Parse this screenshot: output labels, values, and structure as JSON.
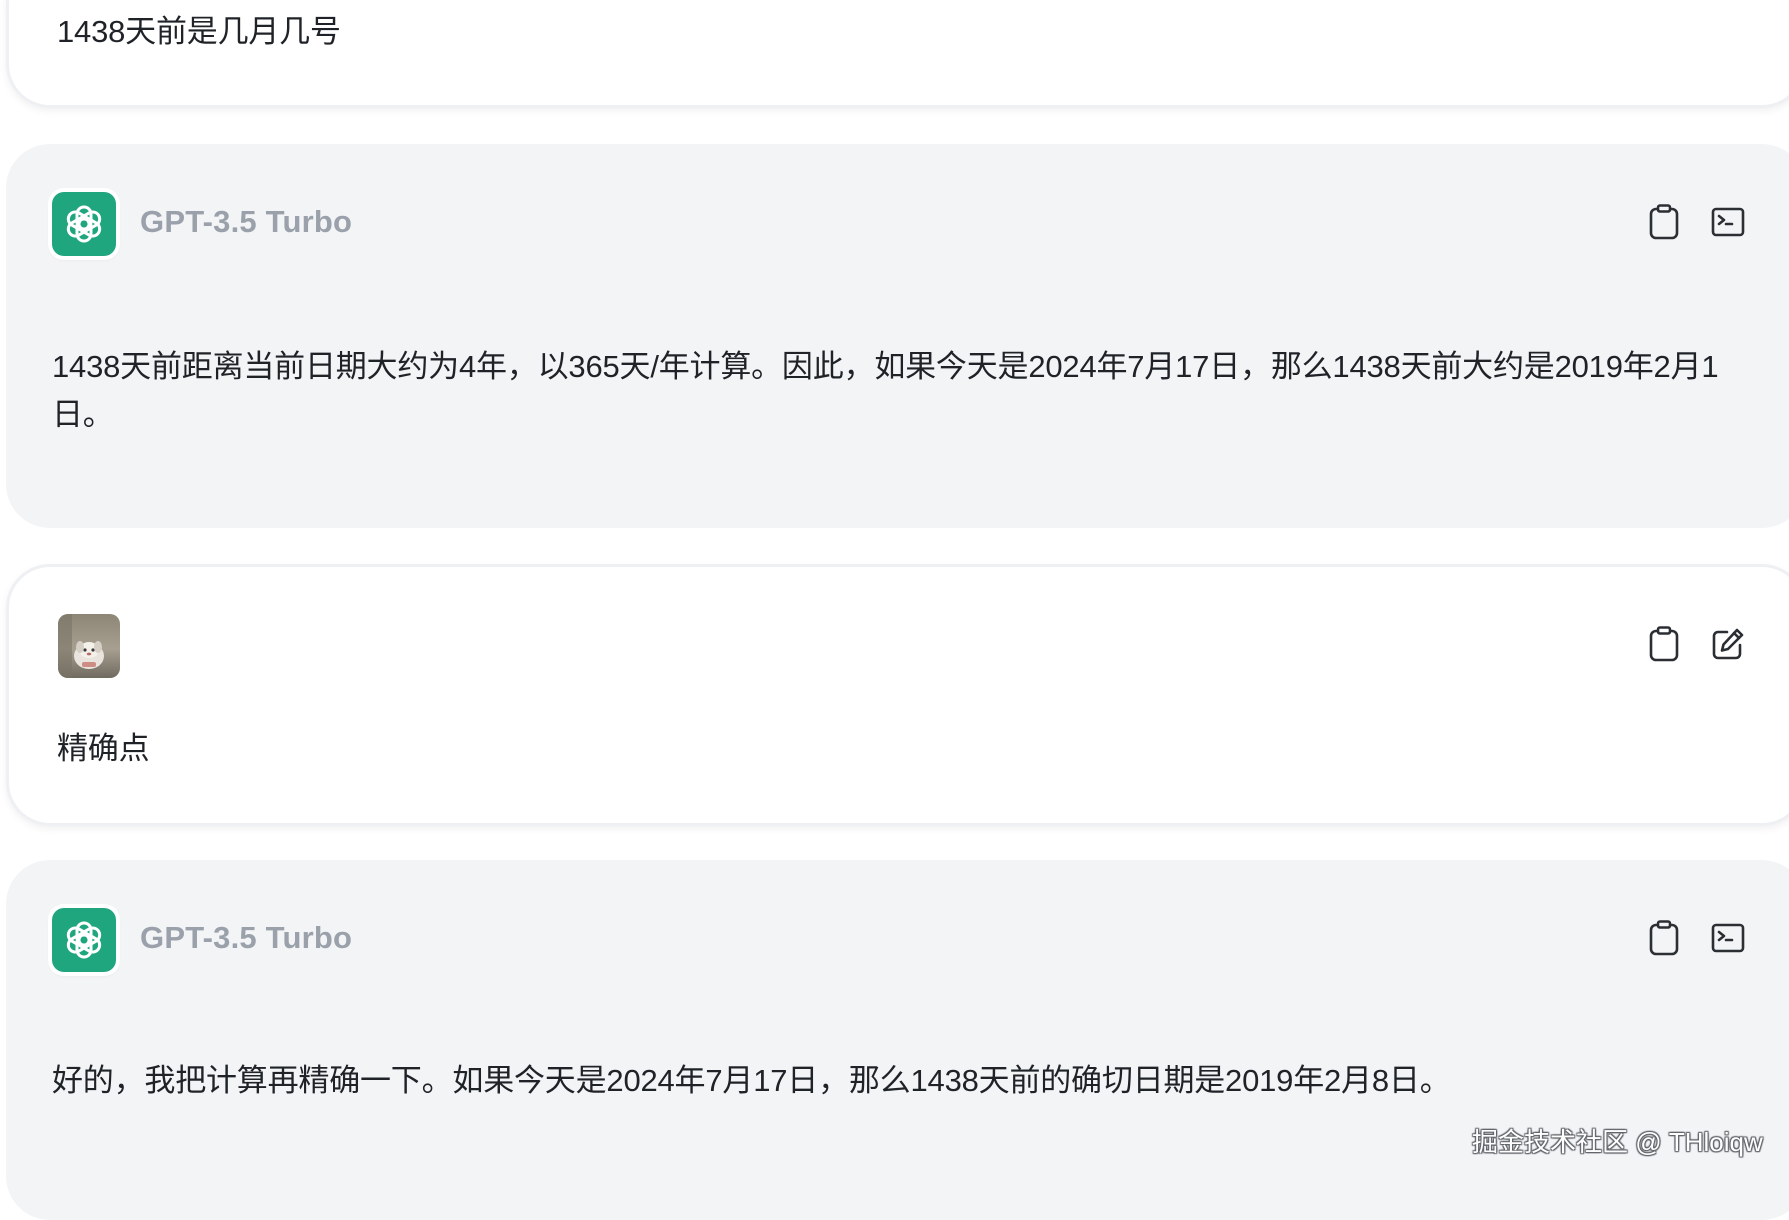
{
  "messages": [
    {
      "role": "user",
      "text": "1438天前是几月几号"
    },
    {
      "role": "assistant",
      "model_name": "GPT-3.5 Turbo",
      "text": "1438天前距离当前日期大约为4年，以365天/年计算。因此，如果今天是2024年7月17日，那么1438天前大约是2019年2月1日。",
      "actions": [
        "clipboard-icon",
        "terminal-icon"
      ]
    },
    {
      "role": "user",
      "text": "精确点",
      "actions": [
        "clipboard-icon",
        "edit-icon"
      ]
    },
    {
      "role": "assistant",
      "model_name": "GPT-3.5 Turbo",
      "text": "好的，我把计算再精确一下。如果今天是2024年7月17日，那么1438天前的确切日期是2019年2月8日。",
      "actions": [
        "clipboard-icon",
        "terminal-icon"
      ]
    }
  ],
  "watermark": "掘金技术社区 @ THloiqw",
  "colors": {
    "gpt_brand": "#1fa67f",
    "assistant_bg": "#f3f4f6",
    "user_bg": "#ffffff",
    "model_name": "#9aa1aa",
    "icon_stroke": "#2b2f33"
  }
}
